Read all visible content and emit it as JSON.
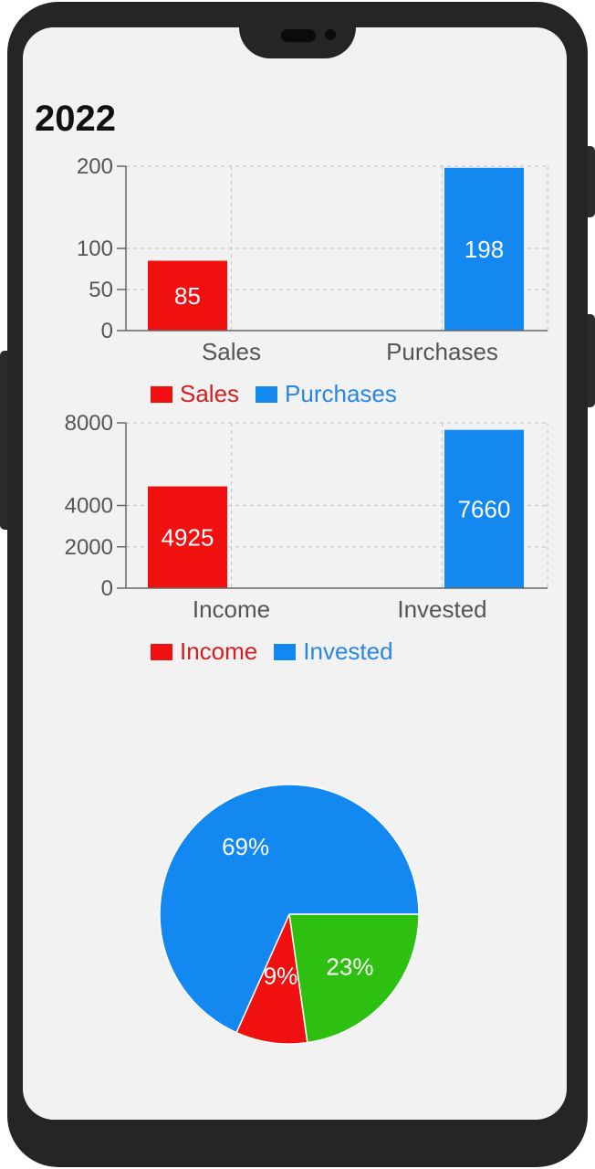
{
  "page": {
    "title": "2022"
  },
  "colors": {
    "red": "#f01010",
    "blue": "#1288f0",
    "green": "#2ec010"
  },
  "chart_data": [
    {
      "type": "bar",
      "categories": [
        "Sales",
        "Purchases"
      ],
      "values": [
        85,
        198
      ],
      "colors": [
        "#f01010",
        "#1288f0"
      ],
      "ylim": [
        0,
        200
      ],
      "yticks": [
        0,
        50,
        100,
        200
      ],
      "legend": [
        "Sales",
        "Purchases"
      ],
      "grid": true
    },
    {
      "type": "bar",
      "categories": [
        "Income",
        "Invested"
      ],
      "values": [
        4925,
        7660
      ],
      "colors": [
        "#f01010",
        "#1288f0"
      ],
      "ylim": [
        0,
        8000
      ],
      "yticks": [
        0,
        2000,
        4000,
        8000
      ],
      "legend": [
        "Income",
        "Invested"
      ],
      "grid": true
    },
    {
      "type": "pie",
      "slices": [
        {
          "label": "23%",
          "value": 23,
          "color": "#2ec010"
        },
        {
          "label": "9%",
          "value": 9,
          "color": "#f01010"
        },
        {
          "label": "69%",
          "value": 69,
          "color": "#1288f0"
        }
      ]
    }
  ]
}
